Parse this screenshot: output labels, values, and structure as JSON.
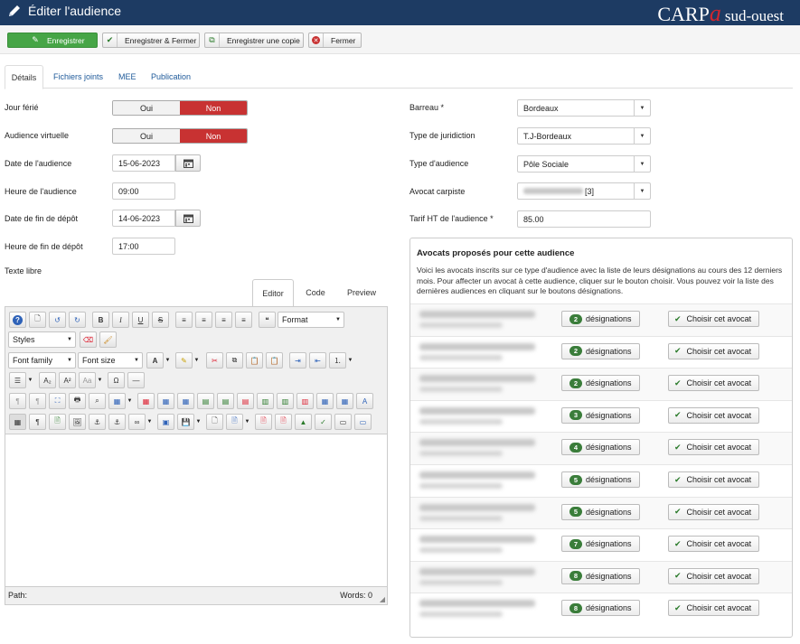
{
  "header": {
    "title": "Éditer l'audience",
    "brand_main": "CARP",
    "brand_accent": "a",
    "brand_suffix": "sud-ouest",
    "bg_color": "#1d3b63"
  },
  "toolbar": {
    "save": "Enregistrer",
    "save_close": "Enregistrer & Fermer",
    "save_copy": "Enregistrer une copie",
    "close": "Fermer"
  },
  "tabs": [
    "Détails",
    "Fichiers joints",
    "MEE",
    "Publication"
  ],
  "form": {
    "jour_ferie": {
      "label": "Jour férié",
      "yes": "Oui",
      "no": "Non"
    },
    "audience_virtuelle": {
      "label": "Audience virtuelle",
      "yes": "Oui",
      "no": "Non"
    },
    "date_audience": {
      "label": "Date de l'audience",
      "value": "15-06-2023"
    },
    "heure_audience": {
      "label": "Heure de l'audience",
      "value": "09:00"
    },
    "date_fin_depot": {
      "label": "Date de fin de dépôt",
      "value": "14-06-2023"
    },
    "heure_fin_depot": {
      "label": "Heure de fin de dépôt",
      "value": "17:00"
    },
    "texte_libre": {
      "label": "Texte libre"
    },
    "barreau": {
      "label": "Barreau *",
      "value": "Bordeaux"
    },
    "type_juridiction": {
      "label": "Type de juridiction",
      "value": "T.J-Bordeaux"
    },
    "type_audience": {
      "label": "Type d'audience",
      "value": "Pôle Sociale"
    },
    "avocat_carpiste": {
      "label": "Avocat carpiste",
      "value_suffix": "[3]"
    },
    "tarif": {
      "label": "Tarif HT de l'audience *",
      "value": "85.00"
    }
  },
  "editor": {
    "tabs": [
      "Editor",
      "Code",
      "Preview"
    ],
    "format": "Format",
    "styles": "Styles",
    "font_family": "Font family",
    "font_size": "Font size",
    "path_label": "Path:",
    "words_label": "Words: 0"
  },
  "panel": {
    "title": "Avocats proposés pour cette audience",
    "description": "Voici les avocats inscrits sur ce type d'audience avec la liste de leurs désignations au cours des 12 derniers mois. Pour affecter un avocat à cette audience, cliquer sur le bouton choisir. Vous pouvez voir la liste des dernières audiences en cliquant sur le boutons désignations.",
    "designations_label": "désignations",
    "choose_label": "Choisir cet avocat",
    "rows": [
      {
        "count": "2"
      },
      {
        "count": "2"
      },
      {
        "count": "2"
      },
      {
        "count": "3"
      },
      {
        "count": "4"
      },
      {
        "count": "5"
      },
      {
        "count": "5"
      },
      {
        "count": "7"
      },
      {
        "count": "8"
      },
      {
        "count": "8"
      }
    ]
  }
}
